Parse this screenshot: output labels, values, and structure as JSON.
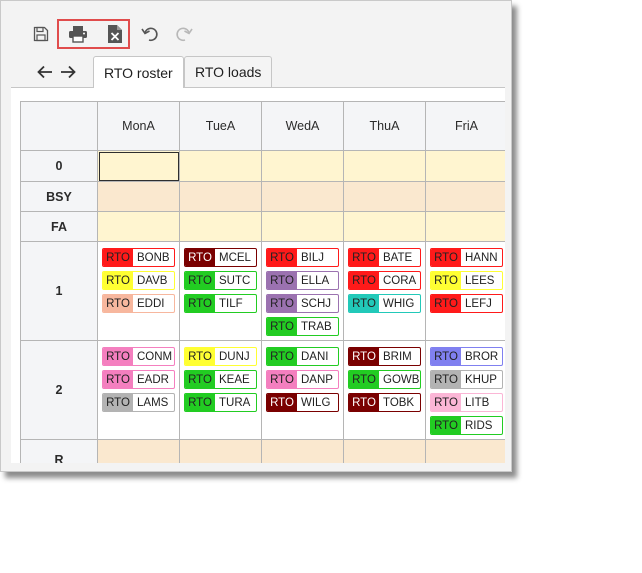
{
  "toolbar": {
    "icons": [
      "save-icon",
      "print-icon",
      "export-excel-icon",
      "undo-icon",
      "redo-icon"
    ]
  },
  "tabs": [
    {
      "label": "RTO roster",
      "active": true
    },
    {
      "label": "RTO loads",
      "active": false
    }
  ],
  "table": {
    "columns": [
      "MonA",
      "TueA",
      "WedA",
      "ThuA",
      "FriA"
    ],
    "rows": [
      {
        "label": "0",
        "bg": "yellow"
      },
      {
        "label": "BSY",
        "bg": "orange"
      },
      {
        "label": "FA",
        "bg": "yellow"
      },
      {
        "label": "1",
        "bg": "white"
      },
      {
        "label": "2",
        "bg": "white"
      },
      {
        "label": "R",
        "bg": "orange"
      }
    ],
    "chips": [
      {
        "row": 3,
        "col": 0,
        "items": [
          {
            "tag": "RTO",
            "name": "BONB",
            "color": "#ff1a1a",
            "text": "#222222"
          },
          {
            "tag": "RTO",
            "name": "DAVB",
            "color": "#ffff33",
            "text": "#222222"
          },
          {
            "tag": "RTO",
            "name": "EDDI",
            "color": "#f7b79e",
            "text": "#222222"
          }
        ]
      },
      {
        "row": 3,
        "col": 1,
        "items": [
          {
            "tag": "RTO",
            "name": "MCEL",
            "color": "#7a0000",
            "text": "#ffffff"
          },
          {
            "tag": "RTO",
            "name": "SUTC",
            "color": "#22cc22",
            "text": "#222222"
          },
          {
            "tag": "RTO",
            "name": "TILF",
            "color": "#22cc22",
            "text": "#222222"
          }
        ]
      },
      {
        "row": 3,
        "col": 2,
        "items": [
          {
            "tag": "RTO",
            "name": "BILJ",
            "color": "#ff1a1a",
            "text": "#222222"
          },
          {
            "tag": "RTO",
            "name": "ELLA",
            "color": "#9b72b0",
            "text": "#222222"
          },
          {
            "tag": "RTO",
            "name": "SCHJ",
            "color": "#9b72b0",
            "text": "#222222"
          },
          {
            "tag": "RTO",
            "name": "TRAB",
            "color": "#22cc22",
            "text": "#222222"
          }
        ]
      },
      {
        "row": 3,
        "col": 3,
        "items": [
          {
            "tag": "RTO",
            "name": "BATE",
            "color": "#ff1a1a",
            "text": "#222222"
          },
          {
            "tag": "RTO",
            "name": "CORA",
            "color": "#ff1a1a",
            "text": "#222222"
          },
          {
            "tag": "RTO",
            "name": "WHIG",
            "color": "#22c9b9",
            "text": "#222222"
          }
        ]
      },
      {
        "row": 3,
        "col": 4,
        "items": [
          {
            "tag": "RTO",
            "name": "HANN",
            "color": "#ff1a1a",
            "text": "#222222"
          },
          {
            "tag": "RTO",
            "name": "LEES",
            "color": "#ffff33",
            "text": "#222222"
          },
          {
            "tag": "RTO",
            "name": "LEFJ",
            "color": "#ff1a1a",
            "text": "#222222"
          }
        ]
      },
      {
        "row": 4,
        "col": 0,
        "items": [
          {
            "tag": "RTO",
            "name": "CONM",
            "color": "#f47fbf",
            "text": "#222222"
          },
          {
            "tag": "RTO",
            "name": "EADR",
            "color": "#f47fbf",
            "text": "#222222"
          },
          {
            "tag": "RTO",
            "name": "LAMS",
            "color": "#b3b3b3",
            "text": "#222222"
          }
        ]
      },
      {
        "row": 4,
        "col": 1,
        "items": [
          {
            "tag": "RTO",
            "name": "DUNJ",
            "color": "#ffff33",
            "text": "#222222"
          },
          {
            "tag": "RTO",
            "name": "KEAE",
            "color": "#22cc22",
            "text": "#222222"
          },
          {
            "tag": "RTO",
            "name": "TURA",
            "color": "#22cc22",
            "text": "#222222"
          }
        ]
      },
      {
        "row": 4,
        "col": 2,
        "items": [
          {
            "tag": "RTO",
            "name": "DANI",
            "color": "#22cc22",
            "text": "#222222"
          },
          {
            "tag": "RTO",
            "name": "DANP",
            "color": "#f47fbf",
            "text": "#222222"
          },
          {
            "tag": "RTO",
            "name": "WILG",
            "color": "#7a0000",
            "text": "#ffffff"
          }
        ]
      },
      {
        "row": 4,
        "col": 3,
        "items": [
          {
            "tag": "RTO",
            "name": "BRIM",
            "color": "#7a0000",
            "text": "#ffffff"
          },
          {
            "tag": "RTO",
            "name": "GOWB",
            "color": "#22cc22",
            "text": "#222222"
          },
          {
            "tag": "RTO",
            "name": "TOBK",
            "color": "#7a0000",
            "text": "#ffffff"
          }
        ]
      },
      {
        "row": 4,
        "col": 4,
        "items": [
          {
            "tag": "RTO",
            "name": "BROR",
            "color": "#8080f0",
            "text": "#222222"
          },
          {
            "tag": "RTO",
            "name": "KHUP",
            "color": "#b3b3b3",
            "text": "#222222"
          },
          {
            "tag": "RTO",
            "name": "LITB",
            "color": "#fbb6d6",
            "text": "#222222"
          },
          {
            "tag": "RTO",
            "name": "RIDS",
            "color": "#22cc22",
            "text": "#222222"
          }
        ]
      }
    ]
  },
  "colors": {
    "highlight_box": "#e04c4c",
    "yellow_row": "#fff5d0",
    "orange_row": "#fae8cf"
  }
}
